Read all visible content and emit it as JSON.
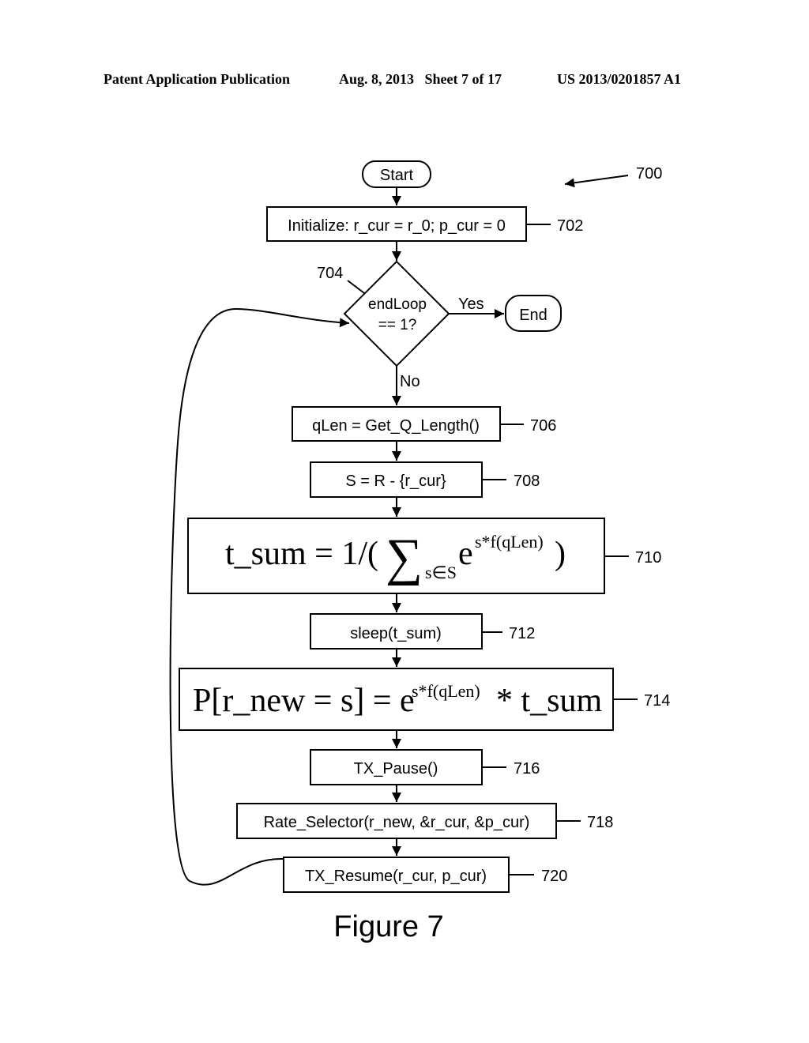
{
  "header": {
    "publication": "Patent Application Publication",
    "date_sheet": "Aug. 8, 2013   Sheet 7 of 17",
    "number": "US 2013/0201857 A1"
  },
  "figure": {
    "ref": "700",
    "caption": "Figure 7",
    "start": {
      "label": "Start"
    },
    "end": {
      "label": "End"
    },
    "steps": [
      {
        "ref": "702",
        "label": "Initialize: r_cur = r_0; p_cur = 0"
      },
      {
        "ref": "704",
        "line1": "endLoop",
        "line2": "== 1?",
        "yes": "Yes",
        "no": "No"
      },
      {
        "ref": "706",
        "label": "qLen = Get_Q_Length()"
      },
      {
        "ref": "708",
        "label": "S = R - {r_cur}"
      },
      {
        "ref": "710",
        "lhs": "t_sum = 1/(",
        "sigma": "∑",
        "sub": "s∈S",
        "base": "e",
        "exp": "s*f(qLen)",
        "close": ")"
      },
      {
        "ref": "712",
        "label": "sleep(t_sum)"
      },
      {
        "ref": "714",
        "lhs": "P[r_new = s] = e",
        "exp": "s*f(qLen)",
        "rhs": "* t_sum"
      },
      {
        "ref": "716",
        "label": "TX_Pause()"
      },
      {
        "ref": "718",
        "label": "Rate_Selector(r_new, &r_cur, &p_cur)"
      },
      {
        "ref": "720",
        "label": "TX_Resume(r_cur, p_cur)"
      }
    ]
  }
}
